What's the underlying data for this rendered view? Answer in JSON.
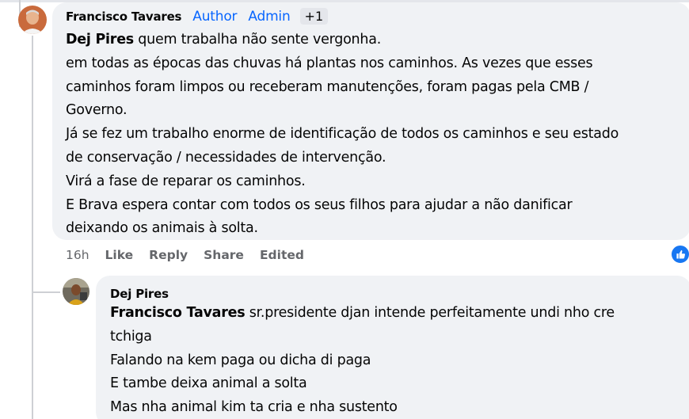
{
  "comment": {
    "author": "Francisco Tavares",
    "badges": [
      "Author",
      "Admin"
    ],
    "more_badges": "+1",
    "mention": "Dej Pires",
    "lines": [
      " quem trabalha não sente vergonha.",
      "em todas as épocas das chuvas há plantas nos caminhos. As vezes que esses",
      "caminhos foram limpos ou receberam manutenções, foram pagas pela CMB /",
      "Governo.",
      "Já se fez um trabalho enorme de identificação de todos os caminhos e seu estado",
      "de conservação / necessidades de intervenção.",
      "Virá a fase de reparar os caminhos.",
      "E Brava espera contar com todos os seus filhos para ajudar a não danificar",
      "deixando os animais à solta."
    ],
    "time": "16h",
    "like": "Like",
    "reply": "Reply",
    "share": "Share",
    "edited": "Edited"
  },
  "reply": {
    "author": "Dej Pires",
    "mention": "Francisco Tavares",
    "lines": [
      " sr.presidente djan intende perfeitamente undi nho cre",
      "tchiga",
      "Falando na kem paga ou dicha di paga",
      "E tambe deixa animal a solta",
      "Mas nha animal kim ta cria e nha sustento"
    ]
  },
  "colors": {
    "bubble": "#f0f2f5",
    "badge_blue": "#0866ff",
    "secondary_text": "#65676b",
    "like_blue": "#1877f2"
  },
  "icons": [
    "avatar-francisco",
    "avatar-dej",
    "like-reaction-icon"
  ]
}
